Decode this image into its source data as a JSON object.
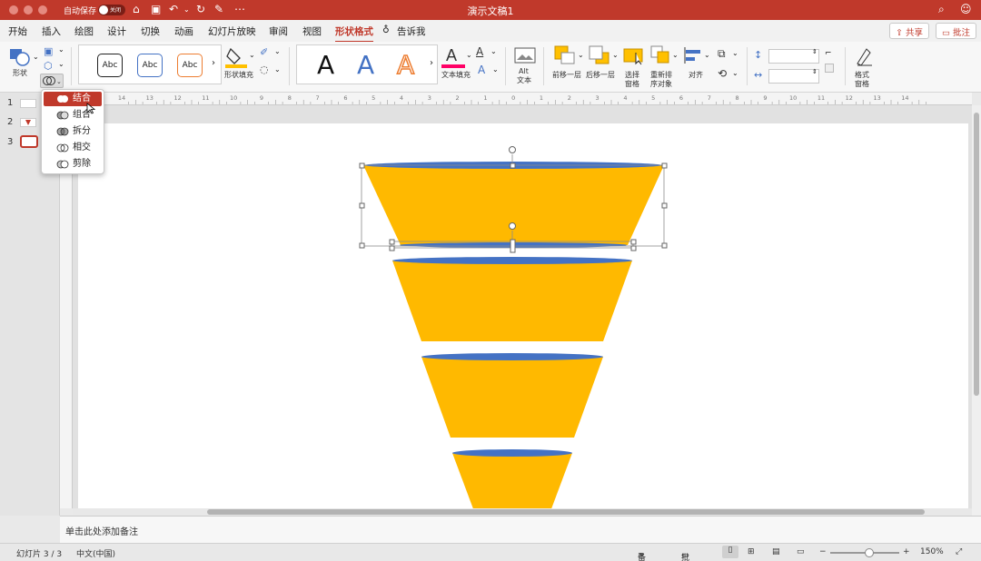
{
  "window": {
    "title": "演示文稿1",
    "autosave_label": "自动保存",
    "autosave_state": "关闭"
  },
  "tabs": [
    {
      "label": "开始"
    },
    {
      "label": "插入"
    },
    {
      "label": "绘图"
    },
    {
      "label": "设计"
    },
    {
      "label": "切换"
    },
    {
      "label": "动画"
    },
    {
      "label": "幻灯片放映"
    },
    {
      "label": "审阅"
    },
    {
      "label": "视图"
    },
    {
      "label": "形状格式",
      "active": true
    },
    {
      "label": "告诉我"
    }
  ],
  "header_buttons": {
    "share": "共享",
    "comment": "批注"
  },
  "ribbon": {
    "shape_label": "形状",
    "style_sample": "Abc",
    "shape_fill_label": "形状填充",
    "wordart_sample": "A",
    "text_fill_label": "文本填充",
    "alt_text_label_1": "Alt",
    "alt_text_label_2": "文本",
    "bring_forward": "前移一层",
    "send_backward": "后移一层",
    "selection_pane_1": "选择",
    "selection_pane_2": "窗格",
    "reorder_1": "重新排",
    "reorder_2": "序对象",
    "align": "对齐",
    "format_pane_1": "格式",
    "format_pane_2": "窗格",
    "colors": {
      "accent": "#c0392b",
      "fill_yellow": "#ffc000",
      "text_red": "#ff0066"
    }
  },
  "merge_menu": {
    "items": [
      {
        "label": "结合",
        "selected": true
      },
      {
        "label": "组合"
      },
      {
        "label": "拆分"
      },
      {
        "label": "相交"
      },
      {
        "label": "剪除"
      }
    ]
  },
  "ruler_ticks": [
    "14",
    "13",
    "12",
    "11",
    "10",
    "9",
    "8",
    "7",
    "6",
    "5",
    "4",
    "3",
    "2",
    "1",
    "0",
    "1",
    "2",
    "3",
    "4",
    "5",
    "6",
    "7",
    "8",
    "9",
    "10",
    "11",
    "12",
    "13",
    "14"
  ],
  "slides_panel": [
    {
      "num": "1"
    },
    {
      "num": "2"
    },
    {
      "num": "3"
    }
  ],
  "funnel": {
    "colors": {
      "body": "#ffb900",
      "top": "#4472c4"
    }
  },
  "notes_placeholder": "单击此处添加备注",
  "status": {
    "slide_info": "幻灯片 3 / 3",
    "language": "中文(中国)",
    "notes_btn": "备注",
    "comments_btn": "批注",
    "zoom": "150%",
    "zoom_minus": "−",
    "zoom_plus": "+"
  }
}
